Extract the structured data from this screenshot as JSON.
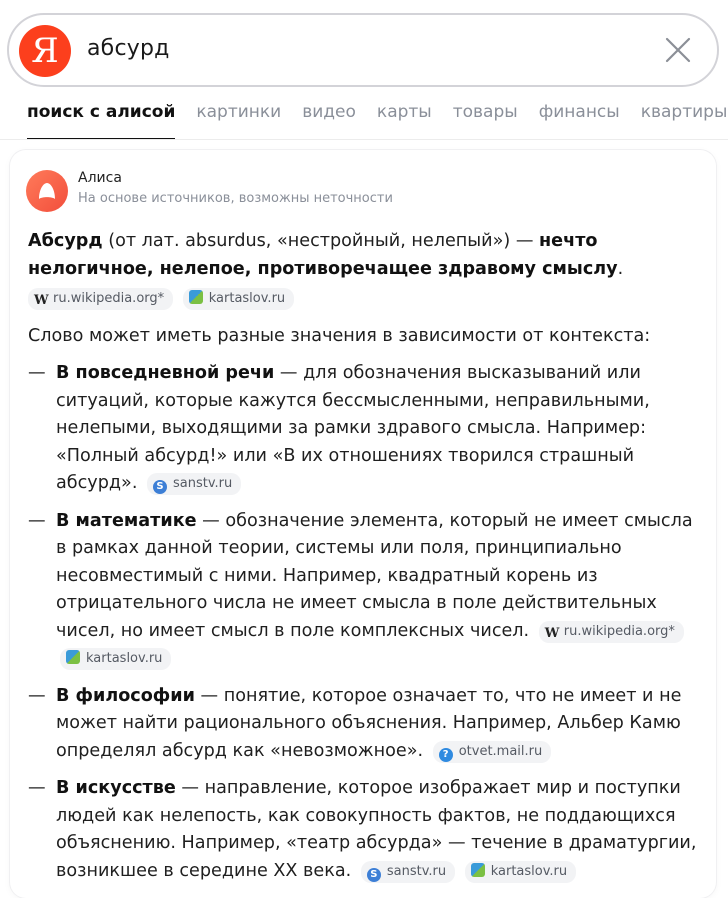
{
  "search": {
    "logo": "Я",
    "query": "абсурд"
  },
  "tabs": [
    {
      "label": "поиск с алисой"
    },
    {
      "label": "картинки"
    },
    {
      "label": "видео"
    },
    {
      "label": "карты"
    },
    {
      "label": "товары"
    },
    {
      "label": "финансы"
    },
    {
      "label": "квартиры"
    }
  ],
  "alice": {
    "name": "Алиса",
    "subtitle": "На основе источников, возможны неточности"
  },
  "answer": {
    "intro_term": "Абсурд",
    "intro_mid": " (от лат. absurdus, «нестройный, нелепый») — ",
    "intro_bold": "нечто нелогичное, нелепое, противоречащее здравому смыслу",
    "intro_end": ".",
    "intro_sources": [
      "ru.wikipedia.org*",
      "kartaslov.ru"
    ],
    "lead": "Слово может иметь разные значения в зависимости от контекста:",
    "dash": "—",
    "items": [
      {
        "term": "В повседневной речи",
        "text": " — для обозначения высказываний или ситуаций, которые кажутся бессмысленными, неправильными, нелепыми, выходящими за рамки здравого смысла. Например: «Полный абсурд!» или «В их отношениях творился страшный абсурд».",
        "sources": [
          "sanstv.ru"
        ]
      },
      {
        "term": "В математике",
        "text": " — обозначение элемента, который не имеет смысла в рамках данной теории, системы или поля, принципиально несовместимый с ними. Например, квадратный корень из отрицательного числа не имеет смысла в поле действительных чисел, но имеет смысл в поле комплексных чисел.",
        "sources": [
          "ru.wikipedia.org*",
          "kartaslov.ru"
        ]
      },
      {
        "term": "В философии",
        "text": " — понятие, которое означает то, что не имеет и не может найти рационального объяснения. Например, Альбер Камю определял абсурд как «невозможное».",
        "sources": [
          "otvet.mail.ru"
        ]
      },
      {
        "term": "В искусстве",
        "text": " — направление, которое изображает мир и поступки людей как нелепость, как совокупность фактов, не поддающихся объяснению. Например, «театр абсурда» — течение в драматургии, возникшее в середине XX века.",
        "sources": [
          "sanstv.ru",
          "kartaslov.ru"
        ]
      }
    ]
  },
  "colors": {
    "brand": "#fc3f1d",
    "muted": "#8a8f99",
    "chip_bg": "#f2f3f5"
  }
}
